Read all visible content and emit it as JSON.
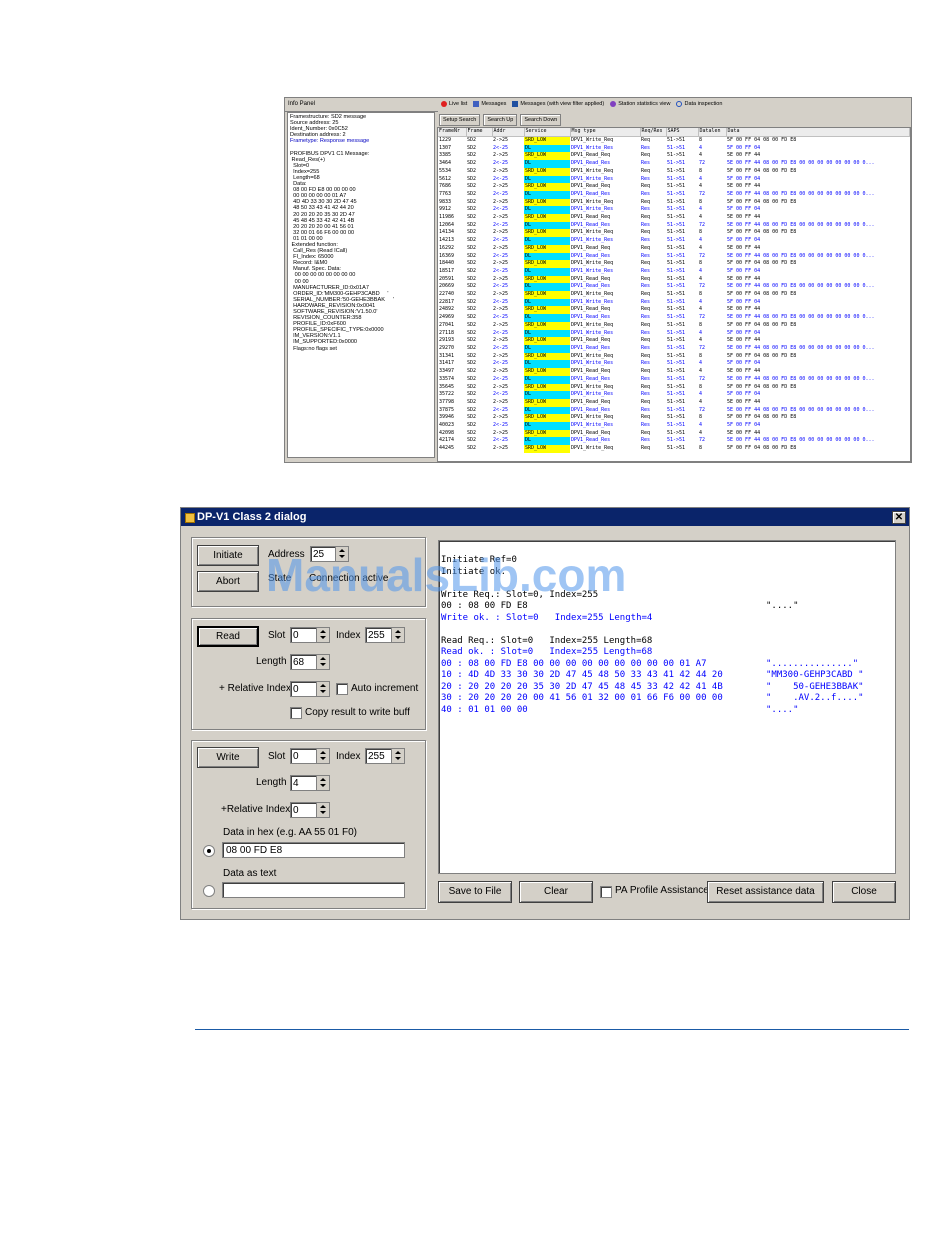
{
  "msg_window": {
    "info_tab": "Info Panel",
    "info_lines": [
      "Framestructure: SD2 message",
      "Source address: 25",
      "Ident_Number: 0x0C52",
      "Destination address: 2",
      "Frametype: Response message",
      "",
      "PROFIBUS DPV1 C1 Message:",
      " Read_Res(+)",
      "  Slot=0",
      "  Index=255",
      "  Length=68",
      "  Data:",
      "  08 00 FD E8 00 00 00 00",
      "  00 00 00 00 00 01 A7",
      "  4D 4D 33 30 30 2D 47 45",
      "  48 50 33 43 41 42 44 20",
      "  20 20 20 20 35 30 2D 47",
      "  45 48 45 33 42 42 41 4B",
      "  20 20 20 20 00 41 56 01",
      "  32 00 01 66 F6 00 00 00",
      "  01 01 00 00",
      " Extended function:",
      "  Call_Res (Read ICall)",
      "  FI_Index: 65000",
      "  Record: I&M0",
      "  Manuf. Spec. Data:",
      "   00 00 00 00 00 00 00 00",
      "   00 00",
      "  MANUFACTURER_ID:0x01A7",
      "  ORDER_ID:'MM300-GEHP3CABD     '",
      "  SERIAL_NUMBER:'50-GEHE3BBAK     '",
      "  HARDWARE_REVISION:0x0041",
      "  SOFTWARE_REVISION:'V1.50.0'",
      "  REVISION_COUNTER:358",
      "  PROFILE_ID:0xF600",
      "  PROFILE_SPECIFIC_TYPE:0x0000",
      "  IM_VERSION:V1.1",
      "  IM_SUPPORTED:0x0000",
      "  Flags:no flags set"
    ],
    "tabs": [
      "Live list",
      "Messages",
      "Messages (with view filter applied)",
      "Station statistics view",
      "Data inspection"
    ],
    "buttons": [
      "Setup Search",
      "Search Up",
      "Search Down"
    ],
    "columns": [
      "FrameNr",
      "Frame",
      "Addr",
      "Service",
      "Msg type",
      "Req/Res",
      "SAPS",
      "Datalen",
      "Data"
    ],
    "rows": [
      [
        "1229",
        "SD2",
        "2->25",
        "SRD_LOW",
        "DPV1_Write_Req",
        "Req",
        "51->51",
        "8",
        "5F 00 FF 04 08 00 FD E8"
      ],
      [
        "1307",
        "SD2",
        "2<-25",
        "DL",
        "DPV1_Write_Res",
        "Res",
        "51->51",
        "4",
        "5F 00 FF 04"
      ],
      [
        "3385",
        "SD2",
        "2->25",
        "SRD_LOW",
        "DPV1_Read_Req",
        "Req",
        "51->51",
        "4",
        "5E 00 FF 44"
      ],
      [
        "3464",
        "SD2",
        "2<-25",
        "DL",
        "DPV1_Read_Res",
        "Res",
        "51->51",
        "72",
        "5E 00 FF 44 08 00 FD E8 00 00 00 00 00 00 00 0..."
      ],
      [
        "5534",
        "SD2",
        "2->25",
        "SRD_LOW",
        "DPV1_Write_Req",
        "Req",
        "51->51",
        "8",
        "5F 00 FF 04 08 00 FD E8"
      ],
      [
        "5612",
        "SD2",
        "2<-25",
        "DL",
        "DPV1_Write_Res",
        "Res",
        "51->51",
        "4",
        "5F 00 FF 04"
      ],
      [
        "7686",
        "SD2",
        "2->25",
        "SRD_LOW",
        "DPV1_Read_Req",
        "Req",
        "51->51",
        "4",
        "5E 00 FF 44"
      ],
      [
        "7763",
        "SD2",
        "2<-25",
        "DL",
        "DPV1_Read_Res",
        "Res",
        "51->51",
        "72",
        "5E 00 FF 44 08 00 FD E8 00 00 00 00 00 00 00 0..."
      ],
      [
        "9833",
        "SD2",
        "2->25",
        "SRD_LOW",
        "DPV1_Write_Req",
        "Req",
        "51->51",
        "8",
        "5F 00 FF 04 08 00 FD E8"
      ],
      [
        "9912",
        "SD2",
        "2<-25",
        "DL",
        "DPV1_Write_Res",
        "Res",
        "51->51",
        "4",
        "5F 00 FF 04"
      ],
      [
        "11986",
        "SD2",
        "2->25",
        "SRD_LOW",
        "DPV1_Read_Req",
        "Req",
        "51->51",
        "4",
        "5E 00 FF 44"
      ],
      [
        "12064",
        "SD2",
        "2<-25",
        "DL",
        "DPV1_Read_Res",
        "Res",
        "51->51",
        "72",
        "5E 00 FF 44 08 00 FD E8 00 00 00 00 00 00 00 0..."
      ],
      [
        "14134",
        "SD2",
        "2->25",
        "SRD_LOW",
        "DPV1_Write_Req",
        "Req",
        "51->51",
        "8",
        "5F 00 FF 04 08 00 FD E8"
      ],
      [
        "14213",
        "SD2",
        "2<-25",
        "DL",
        "DPV1_Write_Res",
        "Res",
        "51->51",
        "4",
        "5F 00 FF 04"
      ],
      [
        "16292",
        "SD2",
        "2->25",
        "SRD_LOW",
        "DPV1_Read_Req",
        "Req",
        "51->51",
        "4",
        "5E 00 FF 44"
      ],
      [
        "16369",
        "SD2",
        "2<-25",
        "DL",
        "DPV1_Read_Res",
        "Res",
        "51->51",
        "72",
        "5E 00 FF 44 08 00 FD E8 00 00 00 00 00 00 00 0..."
      ],
      [
        "18440",
        "SD2",
        "2->25",
        "SRD_LOW",
        "DPV1_Write_Req",
        "Req",
        "51->51",
        "8",
        "5F 00 FF 04 08 00 FD E8"
      ],
      [
        "18517",
        "SD2",
        "2<-25",
        "DL",
        "DPV1_Write_Res",
        "Res",
        "51->51",
        "4",
        "5F 00 FF 04"
      ],
      [
        "20591",
        "SD2",
        "2->25",
        "SRD_LOW",
        "DPV1_Read_Req",
        "Req",
        "51->51",
        "4",
        "5E 00 FF 44"
      ],
      [
        "20669",
        "SD2",
        "2<-25",
        "DL",
        "DPV1_Read_Res",
        "Res",
        "51->51",
        "72",
        "5E 00 FF 44 08 00 FD E8 00 00 00 00 00 00 00 0..."
      ],
      [
        "22740",
        "SD2",
        "2->25",
        "SRD_LOW",
        "DPV1_Write_Req",
        "Req",
        "51->51",
        "8",
        "5F 00 FF 04 08 00 FD E8"
      ],
      [
        "22817",
        "SD2",
        "2<-25",
        "DL",
        "DPV1_Write_Res",
        "Res",
        "51->51",
        "4",
        "5F 00 FF 04"
      ],
      [
        "24892",
        "SD2",
        "2->25",
        "SRD_LOW",
        "DPV1_Read_Req",
        "Req",
        "51->51",
        "4",
        "5E 00 FF 44"
      ],
      [
        "24969",
        "SD2",
        "2<-25",
        "DL",
        "DPV1_Read_Res",
        "Res",
        "51->51",
        "72",
        "5E 00 FF 44 08 00 FD E8 00 00 00 00 00 00 00 0..."
      ],
      [
        "27041",
        "SD2",
        "2->25",
        "SRD_LOW",
        "DPV1_Write_Req",
        "Req",
        "51->51",
        "8",
        "5F 00 FF 04 08 00 FD E8"
      ],
      [
        "27118",
        "SD2",
        "2<-25",
        "DL",
        "DPV1_Write_Res",
        "Res",
        "51->51",
        "4",
        "5F 00 FF 04"
      ],
      [
        "29193",
        "SD2",
        "2->25",
        "SRD_LOW",
        "DPV1_Read_Req",
        "Req",
        "51->51",
        "4",
        "5E 00 FF 44"
      ],
      [
        "29270",
        "SD2",
        "2<-25",
        "DL",
        "DPV1_Read_Res",
        "Res",
        "51->51",
        "72",
        "5E 00 FF 44 08 00 FD E8 00 00 00 00 00 00 00 0..."
      ],
      [
        "31341",
        "SD2",
        "2->25",
        "SRD_LOW",
        "DPV1_Write_Req",
        "Req",
        "51->51",
        "8",
        "5F 00 FF 04 08 00 FD E8"
      ],
      [
        "31417",
        "SD2",
        "2<-25",
        "DL",
        "DPV1_Write_Res",
        "Res",
        "51->51",
        "4",
        "5F 00 FF 04"
      ],
      [
        "33497",
        "SD2",
        "2->25",
        "SRD_LOW",
        "DPV1_Read_Req",
        "Req",
        "51->51",
        "4",
        "5E 00 FF 44"
      ],
      [
        "33574",
        "SD2",
        "2<-25",
        "DL",
        "DPV1_Read_Res",
        "Res",
        "51->51",
        "72",
        "5E 00 FF 44 08 00 FD E8 00 00 00 00 00 00 00 0..."
      ],
      [
        "35645",
        "SD2",
        "2->25",
        "SRD_LOW",
        "DPV1_Write_Req",
        "Req",
        "51->51",
        "8",
        "5F 00 FF 04 08 00 FD E8"
      ],
      [
        "35722",
        "SD2",
        "2<-25",
        "DL",
        "DPV1_Write_Res",
        "Res",
        "51->51",
        "4",
        "5F 00 FF 04"
      ],
      [
        "37798",
        "SD2",
        "2->25",
        "SRD_LOW",
        "DPV1_Read_Req",
        "Req",
        "51->51",
        "4",
        "5E 00 FF 44"
      ],
      [
        "37875",
        "SD2",
        "2<-25",
        "DL",
        "DPV1_Read_Res",
        "Res",
        "51->51",
        "72",
        "5E 00 FF 44 08 00 FD E8 00 00 00 00 00 00 00 0..."
      ],
      [
        "39946",
        "SD2",
        "2->25",
        "SRD_LOW",
        "DPV1_Write_Req",
        "Req",
        "51->51",
        "8",
        "5F 00 FF 04 08 00 FD E8"
      ],
      [
        "40023",
        "SD2",
        "2<-25",
        "DL",
        "DPV1_Write_Res",
        "Res",
        "51->51",
        "4",
        "5F 00 FF 04"
      ],
      [
        "42098",
        "SD2",
        "2->25",
        "SRD_LOW",
        "DPV1_Read_Req",
        "Req",
        "51->51",
        "4",
        "5E 00 FF 44"
      ],
      [
        "42174",
        "SD2",
        "2<-25",
        "DL",
        "DPV1_Read_Res",
        "Res",
        "51->51",
        "72",
        "5E 00 FF 44 08 00 FD E8 00 00 00 00 00 00 00 0..."
      ],
      [
        "44245",
        "SD2",
        "2->25",
        "SRD_LOW",
        "DPV1_Write_Req",
        "Req",
        "51->51",
        "8",
        "5F 00 FF 04 08 00 FD E8"
      ]
    ]
  },
  "dialog": {
    "title": "DP-V1 Class 2 dialog",
    "close_glyph": "✕",
    "conn": {
      "initiate": "Initiate",
      "abort": "Abort",
      "address_label": "Address",
      "address_value": "25",
      "state_label": "State",
      "state_value": "Connection active"
    },
    "read": {
      "button": "Read",
      "slot_label": "Slot",
      "slot_value": "0",
      "index_label": "Index",
      "index_value": "255",
      "length_label": "Length",
      "length_value": "68",
      "rel_index_label": "+ Relative Index",
      "rel_index_value": "0",
      "auto_increment": "Auto increment",
      "copy_result": "Copy result to write buff"
    },
    "write": {
      "button": "Write",
      "slot_label": "Slot",
      "slot_value": "0",
      "index_label": "Index",
      "index_value": "255",
      "length_label": "Length",
      "length_value": "4",
      "rel_index_label": "+Relative Index",
      "rel_index_value": "0",
      "hex_label": "Data in hex (e.g. AA 55 01 F0)",
      "hex_value": "08 00 FD E8",
      "text_label": "Data as text",
      "text_value": ""
    },
    "output": [
      {
        "hex": "Initiate Ref=0",
        "ascii": "",
        "blue": false
      },
      {
        "hex": "Initiate ok.",
        "ascii": "",
        "blue": false
      },
      {
        "hex": "",
        "ascii": "",
        "blue": false
      },
      {
        "hex": "Write Req.: Slot=0, Index=255",
        "ascii": "",
        "blue": false
      },
      {
        "hex": "00 : 08 00 FD E8",
        "ascii": "\"....\"",
        "blue": false
      },
      {
        "hex": "Write ok. : Slot=0   Index=255 Length=4",
        "ascii": "",
        "blue": true
      },
      {
        "hex": "",
        "ascii": "",
        "blue": false
      },
      {
        "hex": "Read Req.: Slot=0   Index=255 Length=68",
        "ascii": "",
        "blue": false
      },
      {
        "hex": "Read ok. : Slot=0   Index=255 Length=68",
        "ascii": "",
        "blue": true
      },
      {
        "hex": "00 : 08 00 FD E8 00 00 00 00 00 00 00 00 00 01 A7",
        "ascii": "\"...............\"",
        "blue": true
      },
      {
        "hex": "10 : 4D 4D 33 30 30 2D 47 45 48 50 33 43 41 42 44 20",
        "ascii": "\"MM300-GEHP3CABD \"",
        "blue": true
      },
      {
        "hex": "20 : 20 20 20 20 35 30 2D 47 45 48 45 33 42 42 41 4B",
        "ascii": "\"    50-GEHE3BBAK\"",
        "blue": true
      },
      {
        "hex": "30 : 20 20 20 20 00 41 56 01 32 00 01 66 F6 00 00 00",
        "ascii": "\"    .AV.2..f....\"",
        "blue": true
      },
      {
        "hex": "40 : 01 01 00 00",
        "ascii": "\"....\"",
        "blue": true
      }
    ],
    "bottom": {
      "save": "Save to File",
      "clear": "Clear",
      "pa_profile": "PA Profile Assistance",
      "reset": "Reset assistance data",
      "close": "Close"
    }
  },
  "watermark": "ManualsLib.com"
}
